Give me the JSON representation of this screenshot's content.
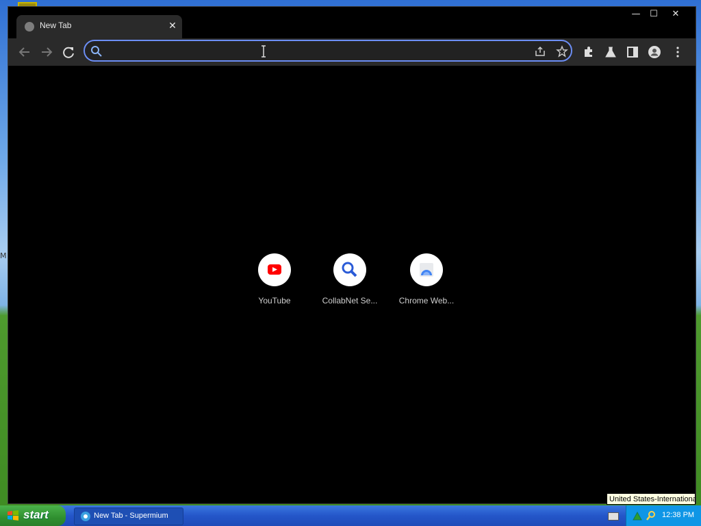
{
  "desktop": {
    "edge_char": "M"
  },
  "browser": {
    "tab": {
      "title": "New Tab",
      "close_glyph": "✕"
    },
    "window_controls": {
      "minimize": "—",
      "maximize": "☐",
      "close": "✕"
    },
    "omnibox": {
      "value": "",
      "placeholder": ""
    },
    "shortcuts": [
      {
        "label": "YouTube",
        "icon": "youtube-icon"
      },
      {
        "label": "CollabNet Se...",
        "icon": "search-icon"
      },
      {
        "label": "Chrome Web...",
        "icon": "chrome-web-store-icon"
      }
    ]
  },
  "taskbar": {
    "start_label": "start",
    "tasks": [
      {
        "label": "New Tab - Supermium"
      }
    ],
    "clock": "12:38 PM",
    "tooltip": "United States-International"
  },
  "colors": {
    "accent": "#6c8ef5",
    "youtube_red": "#ff0000",
    "taskbar_blue": "#2456c9",
    "start_green": "#2f8f2f"
  }
}
